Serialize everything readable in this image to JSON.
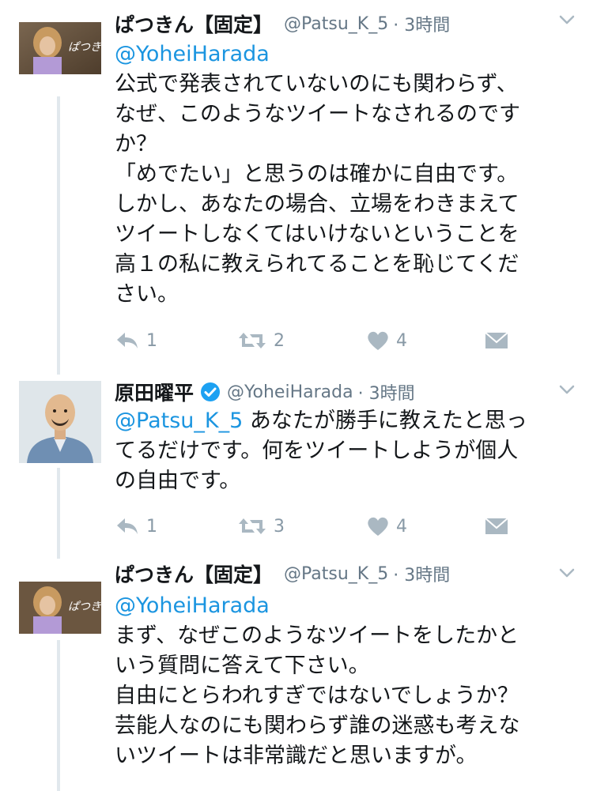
{
  "colors": {
    "accent": "#1b95e0",
    "meta": "#657786",
    "icon": "#aab8c2",
    "thread": "#e1e8ed"
  },
  "tweets": [
    {
      "name": "ぱつきん【固定】",
      "handle": "@Patsu_K_5",
      "time": "· 3時間",
      "mention": "@YoheiHarada",
      "text": "公式で発表されていないのにも関わらず、\nなぜ、このようなツイートなされるのです\nか？\n「めでたい」と思うのは確かに自由です。\nしかし、あなたの場合、立場をわきまえて\nツイートしなくてはいけないということを\n高１の私に教えられてることを恥じてくだ\nさい。",
      "reply_count": "1",
      "retweet_count": "2",
      "like_count": "4"
    },
    {
      "name": "原田曜平",
      "handle": "@YoheiHarada",
      "time": "· 3時間",
      "mention": "@Patsu_K_5",
      "text": " あなたが勝手に教えたと思っ\nてるだけです。何をツイートしようが個人\nの自由です。",
      "reply_count": "1",
      "retweet_count": "3",
      "like_count": "4"
    },
    {
      "name": "ぱつきん【固定】",
      "handle": "@Patsu_K_5",
      "time": "· 3時間",
      "mention": "@YoheiHarada",
      "text": "まず、なぜこのようなツイートをしたかと\nいう質問に答えて下さい。\n自由にとらわれすぎではないでしょうか？\n芸能人なのにも関わらず誰の迷惑も考えな\nいツイートは非常識だと思いますが。"
    }
  ]
}
